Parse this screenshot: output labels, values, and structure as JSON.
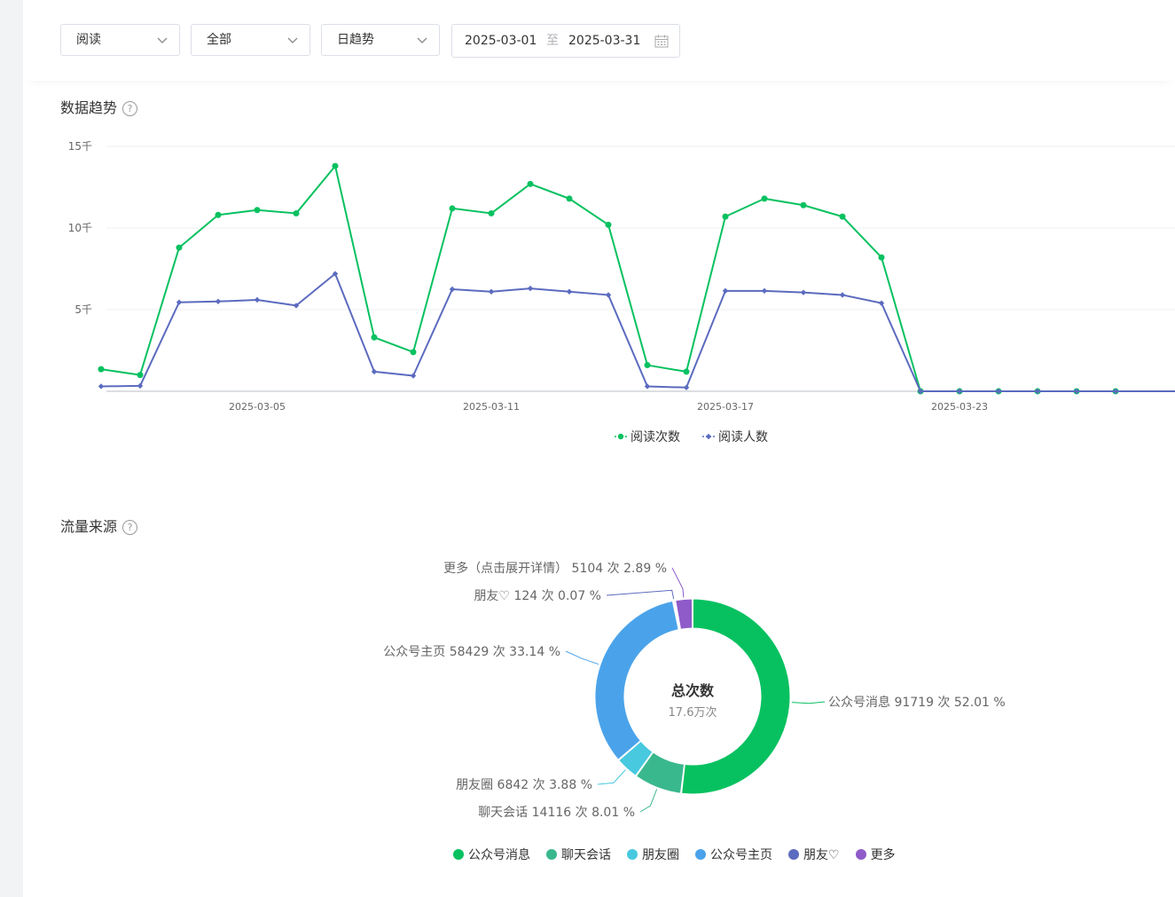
{
  "filters": {
    "metric": "阅读",
    "scope": "全部",
    "granularity": "日趋势",
    "date_start": "2025-03-01",
    "date_sep": "至",
    "date_end": "2025-03-31"
  },
  "trend_section": {
    "title": "数据趋势",
    "help": "?"
  },
  "source_section": {
    "title": "流量来源",
    "help": "?"
  },
  "chart_data": [
    {
      "type": "line",
      "y_ticks": [
        "5千",
        "10千",
        "15千"
      ],
      "y_tick_values": [
        5000,
        10000,
        15000
      ],
      "x_ticks": [
        "2025-03-05",
        "2025-03-11",
        "2025-03-17",
        "2025-03-23"
      ],
      "ylim": [
        0,
        15000
      ],
      "x": [
        "2025-03-01",
        "2025-03-02",
        "2025-03-03",
        "2025-03-04",
        "2025-03-05",
        "2025-03-06",
        "2025-03-07",
        "2025-03-08",
        "2025-03-09",
        "2025-03-10",
        "2025-03-11",
        "2025-03-12",
        "2025-03-13",
        "2025-03-14",
        "2025-03-15",
        "2025-03-16",
        "2025-03-17",
        "2025-03-18",
        "2025-03-19",
        "2025-03-20",
        "2025-03-21",
        "2025-03-22",
        "2025-03-23",
        "2025-03-24",
        "2025-03-25",
        "2025-03-26",
        "2025-03-27"
      ],
      "series": [
        {
          "name": "阅读次数",
          "color": "#07c160",
          "marker": "circle",
          "values": [
            1350,
            1000,
            8800,
            10800,
            11100,
            10900,
            13800,
            3300,
            2400,
            11200,
            10900,
            12700,
            11800,
            10200,
            1600,
            1200,
            10700,
            11800,
            11400,
            10700,
            8200,
            0,
            0,
            0,
            0,
            0,
            0
          ]
        },
        {
          "name": "阅读人数",
          "color": "#5b6bbf",
          "marker": "diamond",
          "values": [
            300,
            330,
            5450,
            5500,
            5600,
            5250,
            7200,
            1200,
            950,
            6250,
            6100,
            6300,
            6100,
            5900,
            300,
            230,
            6150,
            6150,
            6050,
            5900,
            5400,
            0,
            0,
            0,
            0,
            0,
            0
          ]
        }
      ],
      "grid": true,
      "legend_position": "bottom-center"
    },
    {
      "type": "pie",
      "center_title": "总次数",
      "center_value": "17.6万次",
      "slices": [
        {
          "name": "公众号消息",
          "value": 91719,
          "percent": "52.01 %",
          "label": "公众号消息 91719 次 52.01 %",
          "color": "#07c160"
        },
        {
          "name": "聊天会话",
          "value": 14116,
          "percent": "8.01 %",
          "label": "聊天会话 14116 次 8.01 %",
          "color": "#3ab88d"
        },
        {
          "name": "朋友圈",
          "value": 6842,
          "percent": "3.88 %",
          "label": "朋友圈 6842 次 3.88 %",
          "color": "#48c9e0"
        },
        {
          "name": "公众号主页",
          "value": 58429,
          "percent": "33.14 %",
          "label": "公众号主页 58429 次 33.14 %",
          "color": "#4aa3ea"
        },
        {
          "name": "朋友♡",
          "value": 124,
          "percent": "0.07 %",
          "label": "朋友♡ 124 次 0.07 %",
          "color": "#5b6bbf"
        },
        {
          "name": "更多",
          "value": 5104,
          "percent": "2.89 %",
          "label": "更多（点击展开详情） 5104 次 2.89 %",
          "color": "#8e5bc9"
        }
      ],
      "legend_position": "bottom-center"
    }
  ]
}
